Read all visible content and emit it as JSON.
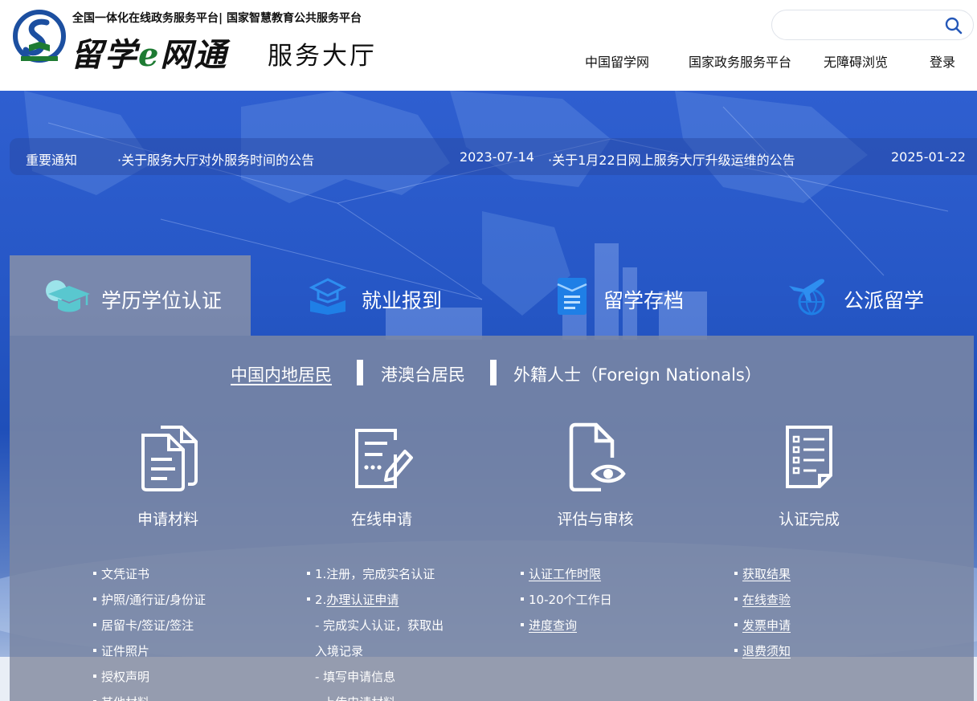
{
  "header": {
    "platform_line": "全国一体化在线政务服务平台| 国家智慧教育公共服务平台",
    "brand_a": "留学",
    "brand_e": "e",
    "brand_b": "网通",
    "brand_hall": "服务大厅",
    "search_placeholder": "",
    "nav": [
      {
        "label": "中国留学网"
      },
      {
        "label": "国家政务服务平台"
      },
      {
        "label": "无障碍浏览"
      },
      {
        "label": "登录"
      }
    ]
  },
  "notices": {
    "label": "重要通知",
    "items": [
      {
        "title": "·关于服务大厅对外服务时间的公告",
        "date": "2023-07-14"
      },
      {
        "title": "·关于1月22日网上服务大厅升级运维的公告",
        "date": "2025-01-22"
      }
    ]
  },
  "services": {
    "tabs": [
      {
        "label": "学历学位认证",
        "icon": "graduation-cap-icon",
        "active": true
      },
      {
        "label": "就业报到",
        "icon": "cap-book-icon",
        "active": false
      },
      {
        "label": "留学存档",
        "icon": "archive-folder-icon",
        "active": false
      },
      {
        "label": "公派留学",
        "icon": "plane-globe-icon",
        "active": false
      }
    ],
    "residency_tabs": [
      {
        "label": "中国内地居民",
        "active": true
      },
      {
        "label": "港澳台居民",
        "active": false
      },
      {
        "label": "外籍人士（Foreign Nationals）",
        "active": false
      }
    ],
    "steps": [
      {
        "title": "申请材料",
        "icon": "documents-icon",
        "items": [
          {
            "text": "文凭证书",
            "type": "bullet",
            "link": false
          },
          {
            "text": "护照/通行证/身份证",
            "type": "bullet",
            "link": false
          },
          {
            "text": "居留卡/签证/签注",
            "type": "bullet",
            "link": false
          },
          {
            "text": "证件照片",
            "type": "bullet",
            "link": false
          },
          {
            "text": "授权声明",
            "type": "bullet",
            "link": false
          },
          {
            "text": "其他材料",
            "type": "bullet",
            "link": false
          }
        ]
      },
      {
        "title": "在线申请",
        "icon": "edit-form-icon",
        "items": [
          {
            "text": "1.注册，完成实名认证",
            "type": "bullet",
            "link": false
          },
          {
            "prefix": "2.",
            "text": "办理认证申请",
            "type": "bullet",
            "link": true
          },
          {
            "text": "- 完成实人认证，获取出",
            "type": "sub",
            "link": false
          },
          {
            "text": "入境记录",
            "type": "sub",
            "link": false
          },
          {
            "text": "- 填写申请信息",
            "type": "sub",
            "link": false
          },
          {
            "text": "- 上传申请材料",
            "type": "sub",
            "link": false
          }
        ]
      },
      {
        "title": "评估与审核",
        "icon": "file-eye-icon",
        "items": [
          {
            "text": "认证工作时限",
            "type": "bullet",
            "link": true
          },
          {
            "text": "10-20个工作日",
            "type": "bullet",
            "link": false
          },
          {
            "text": "进度查询",
            "type": "bullet",
            "link": true
          }
        ]
      },
      {
        "title": "认证完成",
        "icon": "checklist-icon",
        "items": [
          {
            "text": "获取结果",
            "type": "bullet",
            "link": true
          },
          {
            "text": "在线查验",
            "type": "bullet",
            "link": true
          },
          {
            "text": "发票申请",
            "type": "bullet",
            "link": true
          },
          {
            "text": "退费须知",
            "type": "bullet",
            "link": true
          }
        ]
      }
    ]
  },
  "colors": {
    "banner_blue": "#2657c6",
    "panel_gray": "#7a86a4",
    "brand_green": "#1e7b33",
    "logo_blue": "#1c4fa0"
  }
}
